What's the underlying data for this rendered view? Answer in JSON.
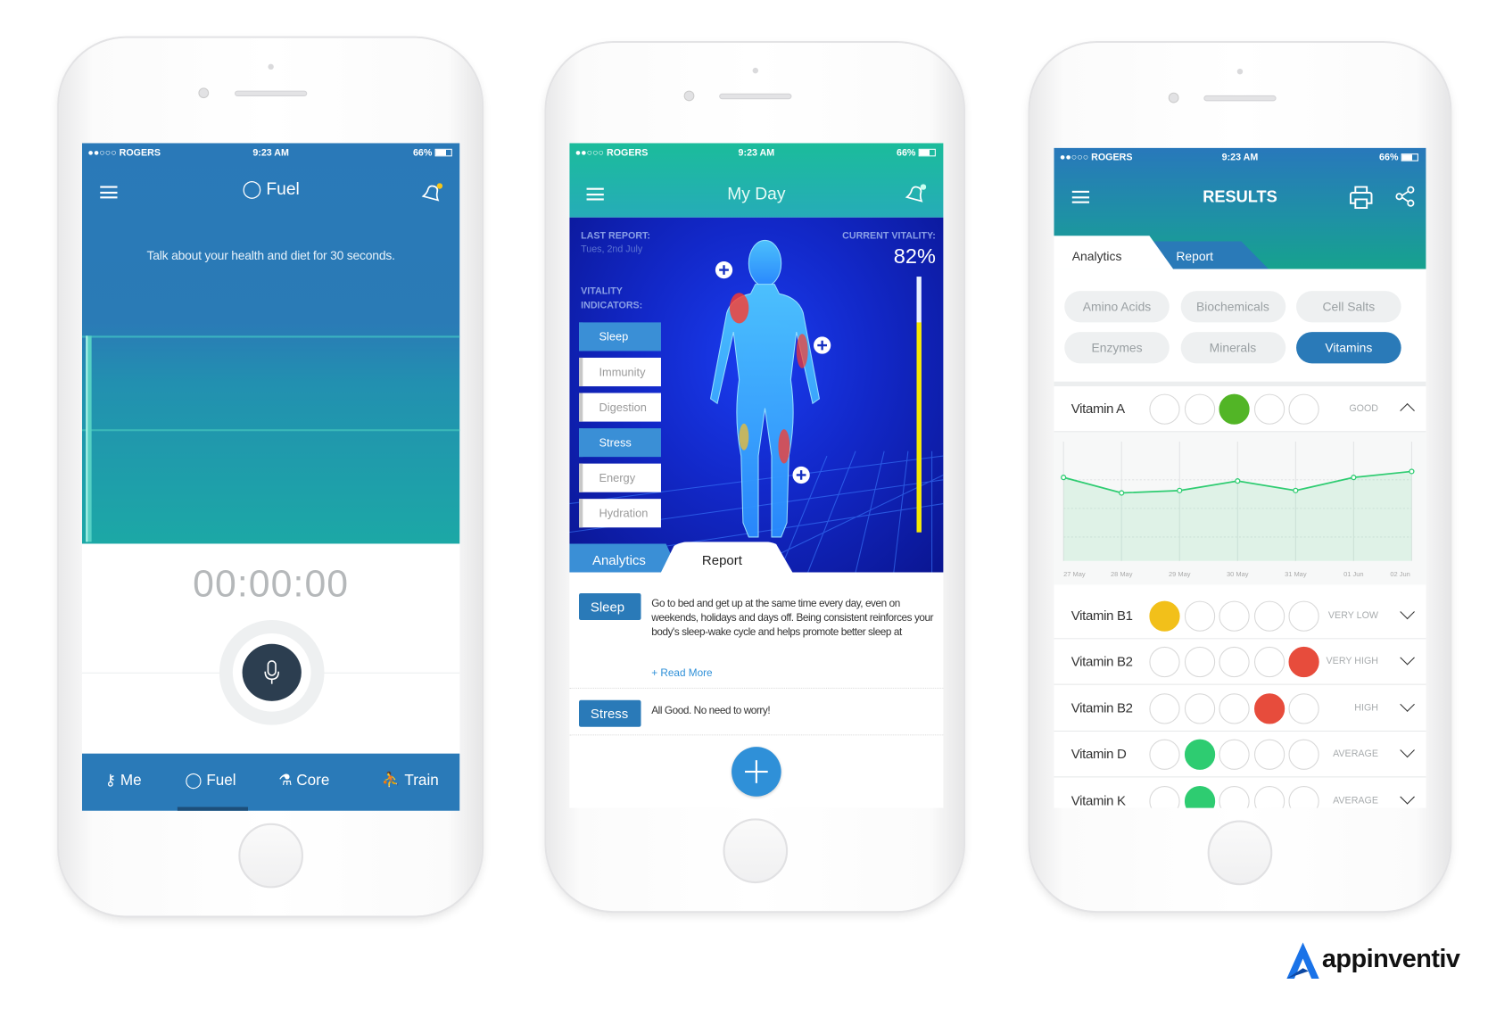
{
  "status_bar": {
    "carrier": "●●○○○ ROGERS",
    "time": "9:23 AM",
    "battery": "66%"
  },
  "fuel_screen": {
    "title": "Fuel",
    "title_icon": "apple-icon",
    "prompt": "Talk about your health and diet for 30 seconds.",
    "timer": "00:00:00",
    "bottom_nav": [
      {
        "label": "Me",
        "icon": "person-icon"
      },
      {
        "label": "Fuel",
        "icon": "apple-icon",
        "active": true
      },
      {
        "label": "Core",
        "icon": "weightlifter-icon"
      },
      {
        "label": "Train",
        "icon": "runner-icon"
      }
    ],
    "colors": {
      "header": "#2a7ab8",
      "wave": "#1fa9a8",
      "mic": "#2c3e50"
    }
  },
  "myday_screen": {
    "title": "My Day",
    "last_report_label": "LAST REPORT:",
    "last_report_date": "Tues, 2nd July",
    "indicators_label": "VITALITY INDICATORS:",
    "indicators": [
      {
        "label": "Sleep",
        "active": true
      },
      {
        "label": "Immunity"
      },
      {
        "label": "Digestion"
      },
      {
        "label": "Stress",
        "active": true
      },
      {
        "label": "Energy"
      },
      {
        "label": "Hydration"
      }
    ],
    "vitality_label": "CURRENT VITALITY:",
    "vitality_value": "82%",
    "vitality_level": 82,
    "tabs": [
      {
        "label": "Analytics"
      },
      {
        "label": "Report",
        "active": true
      }
    ],
    "reports": [
      {
        "tag": "Sleep",
        "text": "Go to bed and get up at the same time every day, even on weekends, holidays and days off. Being consistent reinforces your body's sleep-wake cycle and helps promote better sleep at",
        "link": "+ Read More"
      },
      {
        "tag": "Stress",
        "text": "All Good. No need to worry!"
      }
    ]
  },
  "results_screen": {
    "title": "RESULTS",
    "tabs": [
      {
        "label": "Analytics",
        "active": true
      },
      {
        "label": "Report"
      }
    ],
    "categories": [
      {
        "label": "Amino Acids"
      },
      {
        "label": "Biochemicals"
      },
      {
        "label": "Cell Salts"
      },
      {
        "label": "Enzymes"
      },
      {
        "label": "Minerals"
      },
      {
        "label": "Vitamins",
        "active": true
      }
    ],
    "vitamins": [
      {
        "name": "Vitamin A",
        "level": 3,
        "status": "GOOD",
        "color": "#52b526",
        "expanded": true
      },
      {
        "name": "Vitamin B1",
        "level": 1,
        "status": "VERY LOW",
        "color": "#f2c01a"
      },
      {
        "name": "Vitamin B2",
        "level": 5,
        "status": "VERY HIGH",
        "color": "#e74c3c"
      },
      {
        "name": "Vitamin B2",
        "level": 4,
        "status": "HIGH",
        "color": "#e74c3c"
      },
      {
        "name": "Vitamin D",
        "level": 2,
        "status": "AVERAGE",
        "color": "#2ecc71"
      },
      {
        "name": "Vitamin K",
        "level": 2,
        "status": "AVERAGE",
        "color": "#2ecc71"
      }
    ],
    "chart_data": {
      "type": "area",
      "x": [
        "27 May",
        "28 May",
        "29 May",
        "30 May",
        "31 May",
        "01 Jun",
        "02 Jun"
      ],
      "values": [
        70,
        57,
        59,
        67,
        59,
        70,
        75
      ],
      "ylim": [
        0,
        100
      ],
      "grid": true,
      "color": "#2ecc71"
    }
  },
  "brand": {
    "name": "appinventiv",
    "color": "#1a73e8"
  }
}
